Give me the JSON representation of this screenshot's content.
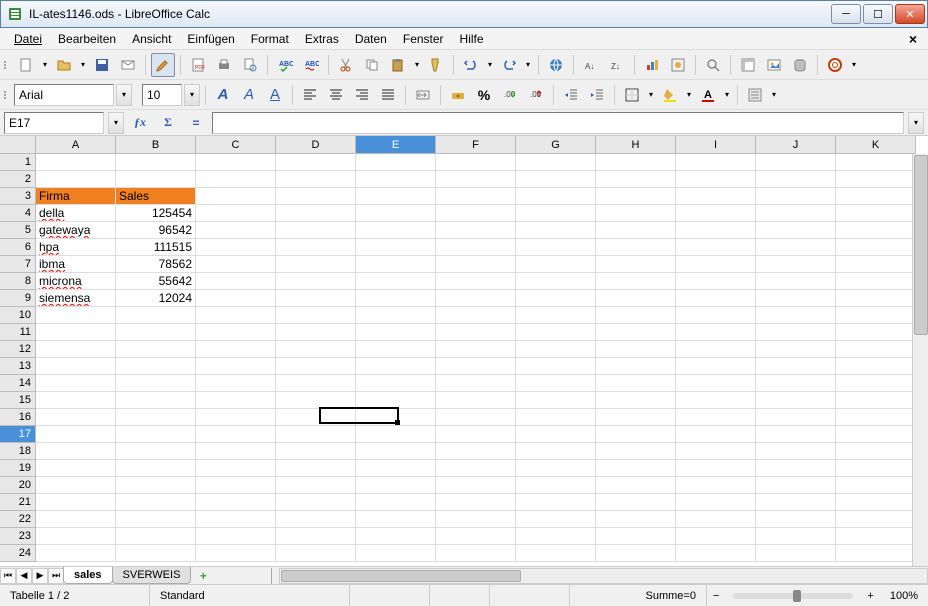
{
  "window": {
    "title": "IL-ates1146.ods - LibreOffice Calc"
  },
  "menu": {
    "items": [
      "Datei",
      "Bearbeiten",
      "Ansicht",
      "Einfügen",
      "Format",
      "Extras",
      "Daten",
      "Fenster",
      "Hilfe"
    ]
  },
  "font": {
    "name": "Arial",
    "size": "10"
  },
  "formula": {
    "cell_ref": "E17",
    "value": ""
  },
  "columns": [
    "A",
    "B",
    "C",
    "D",
    "E",
    "F",
    "G",
    "H",
    "I",
    "J",
    "K"
  ],
  "rows_count": 24,
  "active_col": "E",
  "active_row": 17,
  "headers": {
    "firma": "Firma",
    "sales": "Sales"
  },
  "data": [
    {
      "firma": "della",
      "sales": 125454
    },
    {
      "firma": "gatewaya",
      "sales": 96542
    },
    {
      "firma": "hpa",
      "sales": 111515
    },
    {
      "firma": "ibma",
      "sales": 78562
    },
    {
      "firma": "microna",
      "sales": 55642
    },
    {
      "firma": "siemensa",
      "sales": 12024
    }
  ],
  "tabs": {
    "active": "sales",
    "other": "SVERWEIS"
  },
  "status": {
    "sheet": "Tabelle 1 / 2",
    "mode": "Standard",
    "sum": "Summe=0",
    "zoom": "100%"
  }
}
